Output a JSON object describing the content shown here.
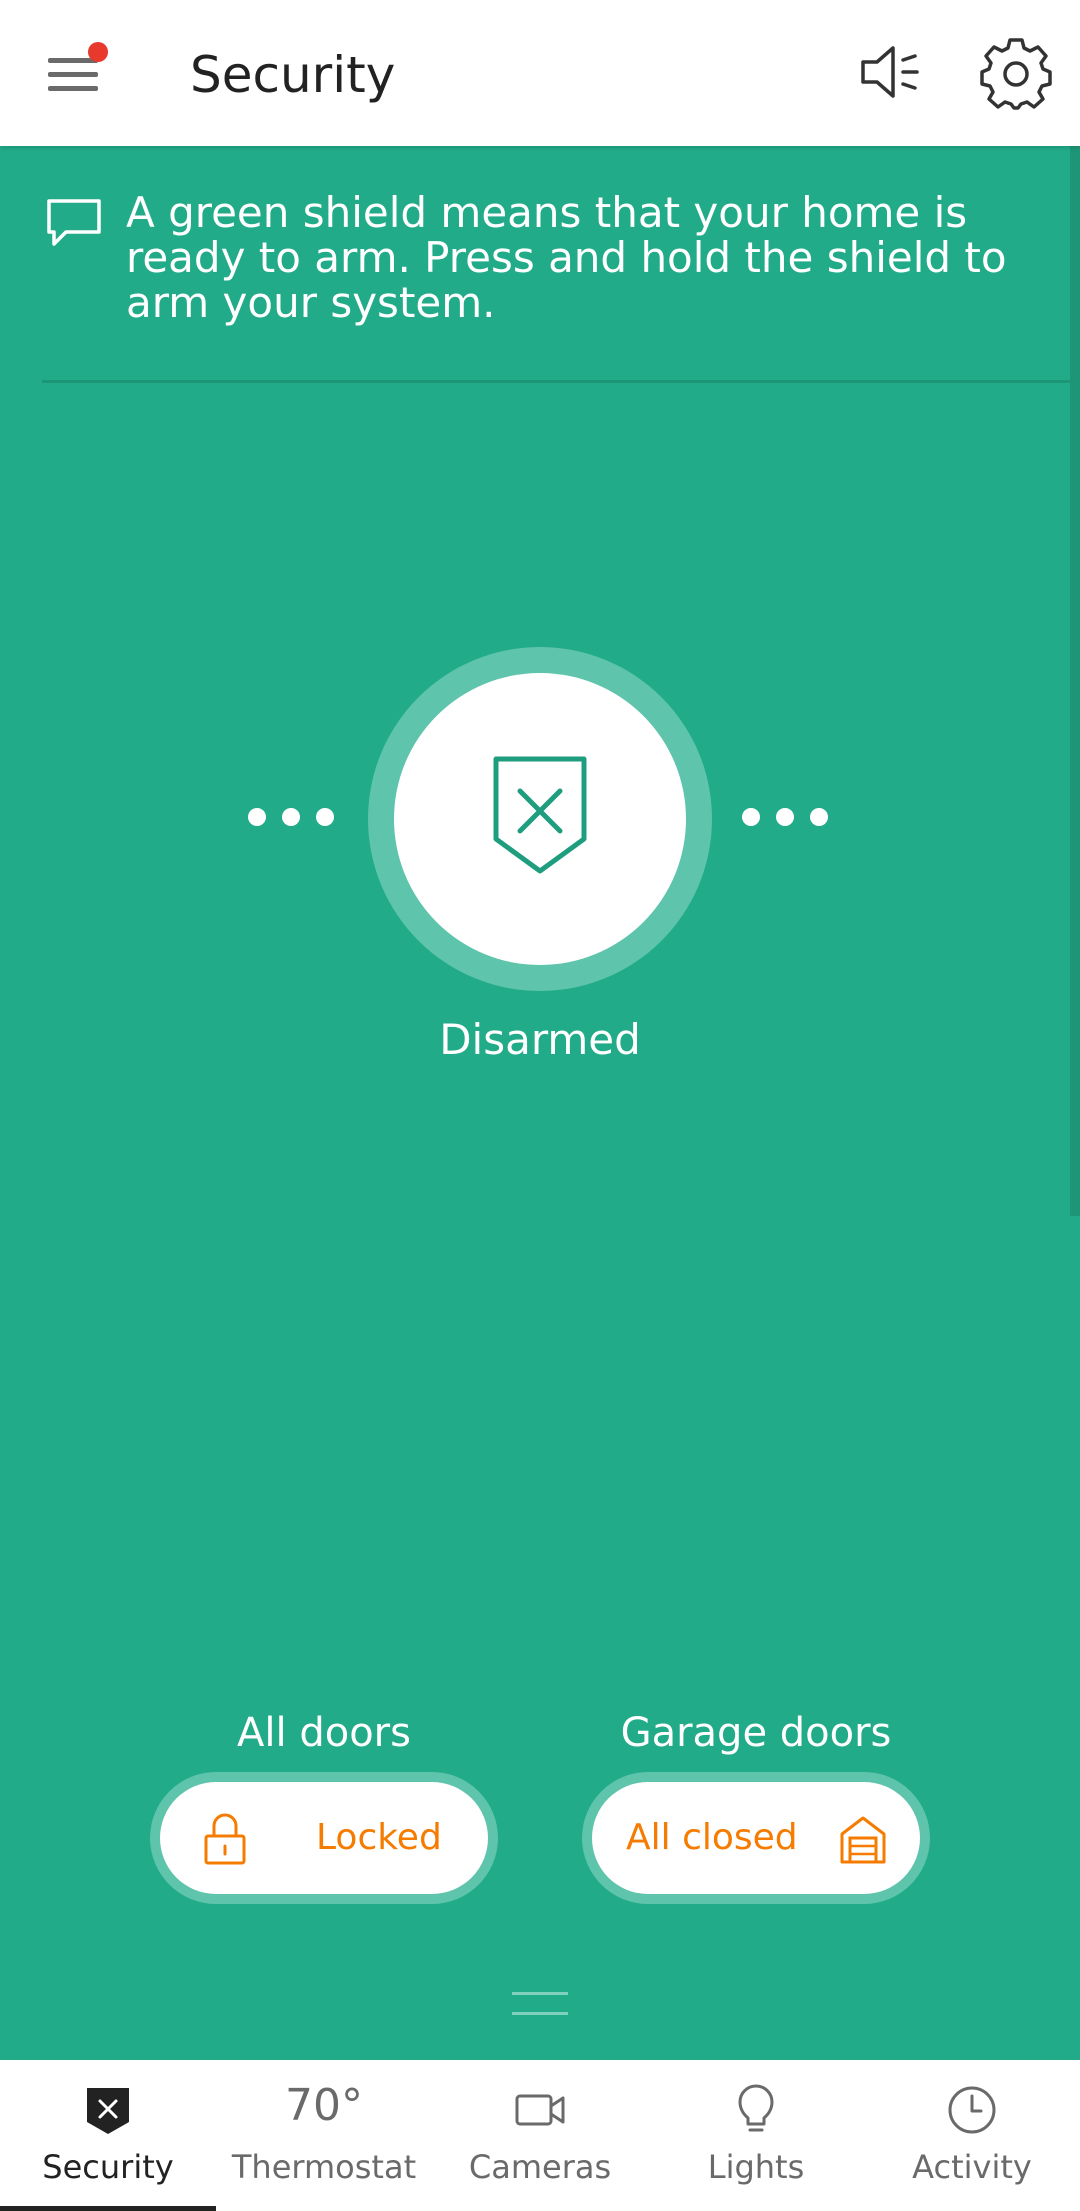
{
  "header": {
    "title": "Security",
    "has_notification": true,
    "icons": [
      "menu-icon",
      "speaker-icon",
      "gear-icon"
    ]
  },
  "banner": {
    "text": "A green shield means that your home is ready to arm. Press and hold the shield to arm your system.",
    "icon": "message-icon"
  },
  "arming": {
    "status": "Disarmed",
    "icon": "shield-x-icon"
  },
  "doors": [
    {
      "label": "All doors",
      "status": "Locked",
      "icon": "lock-icon"
    },
    {
      "label": "Garage doors",
      "status": "All closed",
      "icon": "garage-icon"
    }
  ],
  "bottom_nav": {
    "items": [
      {
        "label": "Security",
        "icon": "shield-icon",
        "active": true
      },
      {
        "label": "Thermostat",
        "value": "70°",
        "active": false
      },
      {
        "label": "Cameras",
        "icon": "camera-icon",
        "active": false
      },
      {
        "label": "Lights",
        "icon": "bulb-icon",
        "active": false
      },
      {
        "label": "Activity",
        "icon": "clock-icon",
        "active": false
      }
    ]
  },
  "colors": {
    "background": "#22ab89",
    "accent_orange": "#f57c00",
    "notification": "#e8392d",
    "shield_green": "#1f9e7f"
  }
}
